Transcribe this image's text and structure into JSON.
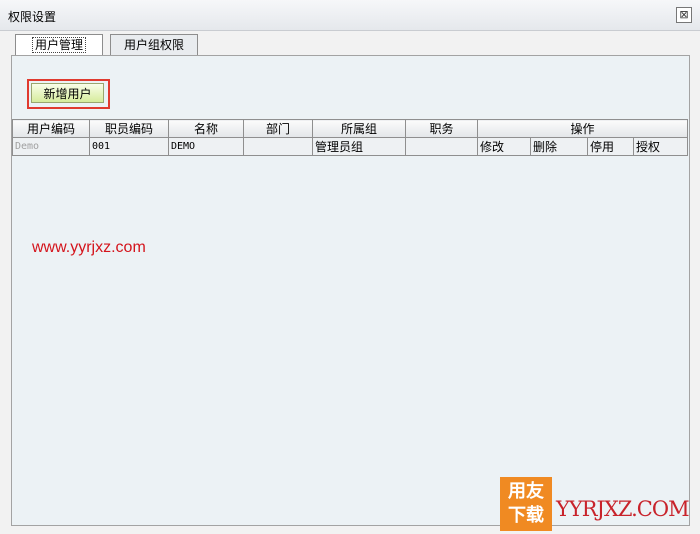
{
  "window": {
    "title": "权限设置",
    "close_glyph": "⊠"
  },
  "tabs": [
    {
      "label": "用户管理",
      "active": true
    },
    {
      "label": "用户组权限",
      "active": false
    }
  ],
  "toolbar": {
    "add_user_label": "新增用户"
  },
  "table": {
    "headers": [
      "用户编码",
      "职员编码",
      "名称",
      "部门",
      "所属组",
      "职务",
      "操作"
    ],
    "rows": [
      {
        "user_code": "Demo",
        "employee_code": "001",
        "name": "DEMO",
        "department": "",
        "group": "管理员组",
        "position": "",
        "actions": [
          "修改",
          "删除",
          "停用",
          "授权"
        ]
      }
    ]
  },
  "watermark": {
    "url": "www.yyrjxz.com",
    "logo_line1": "用友",
    "logo_line2": "下载",
    "brand": "YYRJXZ.COM"
  },
  "colors": {
    "highlight_border": "#e03a2f",
    "url_text": "#d4141c",
    "logo_bg": "#f08a22"
  }
}
